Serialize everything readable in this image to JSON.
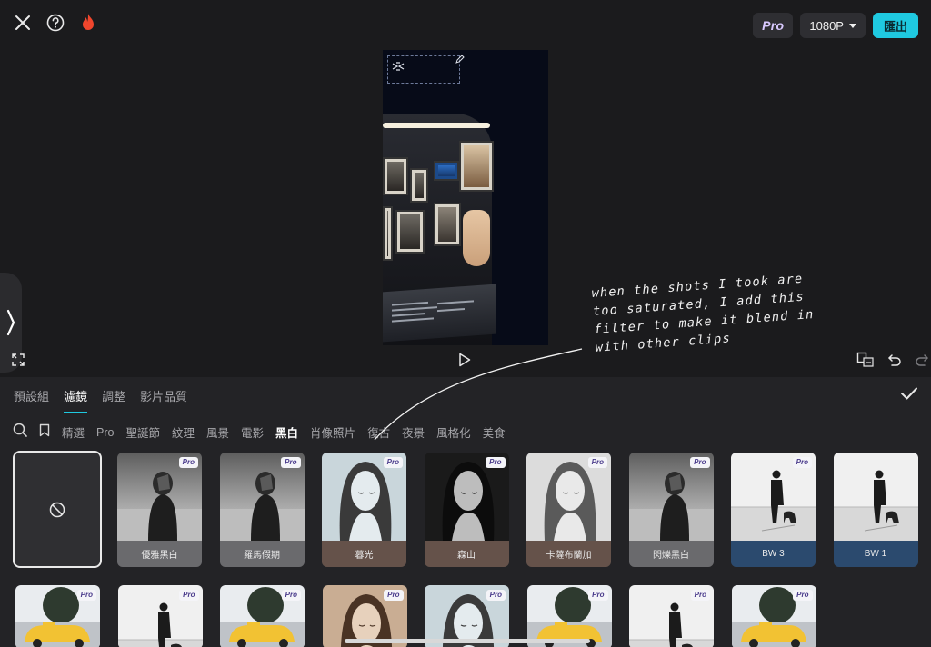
{
  "topbar": {
    "pro_label": "Pro",
    "resolution": "1080P",
    "export_label": "匯出"
  },
  "annotation": {
    "lines": [
      "when the shots I took are",
      "too saturated, I  add this",
      "filter  to make it blend in",
      "with  other clips"
    ]
  },
  "tabs": [
    {
      "label": "預設組",
      "active": false
    },
    {
      "label": "濾鏡",
      "active": true
    },
    {
      "label": "調整",
      "active": false
    },
    {
      "label": "影片品質",
      "active": false
    }
  ],
  "categories": [
    {
      "label": "精選",
      "active": false
    },
    {
      "label": "Pro",
      "active": false
    },
    {
      "label": "聖誕節",
      "active": false
    },
    {
      "label": "紋理",
      "active": false
    },
    {
      "label": "風景",
      "active": false
    },
    {
      "label": "電影",
      "active": false
    },
    {
      "label": "黑白",
      "active": true
    },
    {
      "label": "肖像照片",
      "active": false
    },
    {
      "label": "復古",
      "active": false
    },
    {
      "label": "夜景",
      "active": false
    },
    {
      "label": "風格化",
      "active": false
    },
    {
      "label": "美食",
      "active": false
    }
  ],
  "filters_row1": [
    {
      "name": "優雅黑白",
      "pro": "Pro",
      "label_color": "#6a6a6d",
      "kind": "woman-back"
    },
    {
      "name": "羅馬假期",
      "pro": "Pro",
      "label_color": "#6a6a6d",
      "kind": "woman-back"
    },
    {
      "name": "暮光",
      "pro": "Pro",
      "label_color": "#65524a",
      "kind": "portrait-cool"
    },
    {
      "name": "森山",
      "pro": "Pro",
      "label_color": "#65524a",
      "kind": "portrait-dark"
    },
    {
      "name": "卡薩布蘭加",
      "pro": "Pro",
      "label_color": "#65524a",
      "kind": "portrait-light"
    },
    {
      "name": "閃爍黑白",
      "pro": "Pro",
      "label_color": "#6a6a6d",
      "kind": "woman-back"
    },
    {
      "name": "BW 3",
      "pro": "Pro",
      "label_color": "#2b4a6e",
      "kind": "walker"
    },
    {
      "name": "BW 1",
      "pro": "",
      "label_color": "#2b4a6e",
      "kind": "walker"
    }
  ],
  "filters_row2": [
    {
      "pro": "Pro",
      "kind": "taxi"
    },
    {
      "pro": "Pro",
      "kind": "walker"
    },
    {
      "pro": "Pro",
      "kind": "taxi"
    },
    {
      "pro": "Pro",
      "kind": "portrait-warm"
    },
    {
      "pro": "Pro",
      "kind": "portrait-cool"
    },
    {
      "pro": "Pro",
      "kind": "taxi"
    },
    {
      "pro": "Pro",
      "kind": "walker"
    },
    {
      "pro": "Pro",
      "kind": "taxi"
    }
  ],
  "colors": {
    "accent": "#1fc9e0",
    "pro_text": "#4a3b8c"
  }
}
